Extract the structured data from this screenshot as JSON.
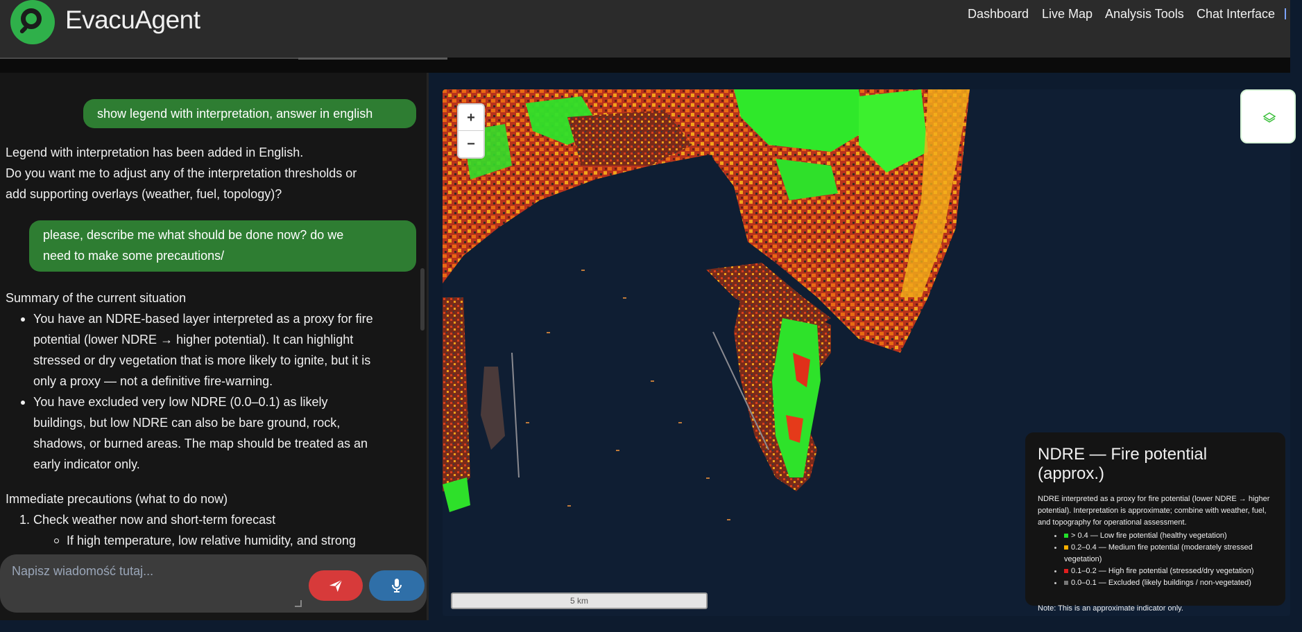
{
  "app": {
    "name": "EvacuAgent"
  },
  "nav": {
    "items": [
      "Dashboard",
      "Live Map",
      "Analysis Tools",
      "Chat Interface"
    ]
  },
  "chat": {
    "messages": {
      "user1": "show legend with interpretation, answer in english",
      "bot1_line1": "Legend with interpretation has been added in English.",
      "bot1_line2": "Do you want me to adjust any of the interpretation thresholds or",
      "bot1_line3": "add supporting overlays (weather, fuel, topology)?",
      "user2_line1": "please, describe me what should be done now? do we",
      "user2_line2": "need to make some precautions/",
      "summary_heading": "Summary of the current situation",
      "bullet1": [
        "You have an NDRE-based layer interpreted as a proxy for fire",
        "potential (lower NDRE → higher potential). It can highlight",
        "stressed or dry vegetation that is more likely to ignite, but it is",
        "only a proxy — not a definitive fire-warning."
      ],
      "bullet2": [
        "You have excluded very low NDRE (0.0–0.1) as likely",
        "buildings, but low NDRE can also be bare ground, rock,",
        "shadows, or burned areas. The map should be treated as an",
        "early indicator only."
      ],
      "precautions_heading": "Immediate precautions (what to do now)",
      "step1_num": "1.",
      "step1": "Check weather now and short-term forecast",
      "sub1": "If high temperature, low relative humidity, and strong"
    },
    "input_placeholder": "Napisz wiadomość tutaj...",
    "send_icon": "send-icon",
    "mic_icon": "microphone-icon"
  },
  "map": {
    "zoom_in": "+",
    "zoom_out": "−",
    "scale_label": "5 km",
    "layers_icon": "layers-icon",
    "legend": {
      "title": "NDRE — Fire potential (approx.)",
      "description": "NDRE interpreted as a proxy for fire potential (lower NDRE → higher potential). Interpretation is approximate; combine with weather, fuel, and topography for operational assessment.",
      "items": [
        {
          "label": "> 0.4 — Low fire potential (healthy vegetation)",
          "color": "#22e02a"
        },
        {
          "label": "0.2–0.4 — Medium fire potential (moderately stressed vegetation)",
          "color": "#ffb000"
        },
        {
          "label": "0.1–0.2 — High fire potential (stressed/dry vegetation)",
          "color": "#e01e1e"
        },
        {
          "label": "0.0–0.1 — Excluded (likely buildings / non-vegetated)",
          "color": "#777777"
        }
      ],
      "note": "Note: This is an approximate indicator only."
    }
  },
  "colors": {
    "accent_green": "#2e7d32",
    "send_red": "#d73a3a",
    "mic_blue": "#2f6fa8",
    "sea": "#0f1e33"
  }
}
